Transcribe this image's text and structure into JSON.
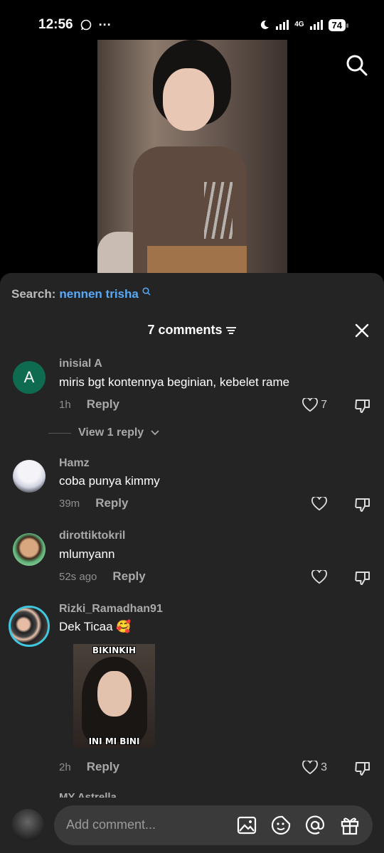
{
  "status_bar": {
    "time": "12:56",
    "network": "4G",
    "battery": "74"
  },
  "search": {
    "label": "Search:",
    "term": "nennen trisha"
  },
  "comments_header": {
    "title": "7 comments"
  },
  "comments": [
    {
      "avatar_letter": "A",
      "avatar_color": "#0e6b4f",
      "username": "inisial A",
      "text": "miris bgt kontennya beginian, kebelet rame",
      "time": "1h",
      "reply_label": "Reply",
      "likes": "7",
      "view_replies": "View 1 reply"
    },
    {
      "username": "Hamz",
      "text": "coba punya kimmy",
      "time": "39m",
      "reply_label": "Reply",
      "likes": ""
    },
    {
      "username": "dirottiktokril",
      "text": "mlumyann",
      "time": "52s ago",
      "reply_label": "Reply",
      "likes": ""
    },
    {
      "username": "Rizki_Ramadhan91",
      "text": "Dek Ticaa 🥰",
      "sticker_top": "BIKINKIH",
      "sticker_bottom": "INI MI BINI",
      "time": "2h",
      "reply_label": "Reply",
      "likes": "3"
    },
    {
      "username": "MY Astrella"
    }
  ],
  "input": {
    "placeholder": "Add comment..."
  },
  "icons": [
    "search-icon",
    "close-icon",
    "heart-icon",
    "dislike-icon",
    "image-icon",
    "emoji-icon",
    "mention-icon",
    "gift-icon",
    "filter-icon"
  ]
}
